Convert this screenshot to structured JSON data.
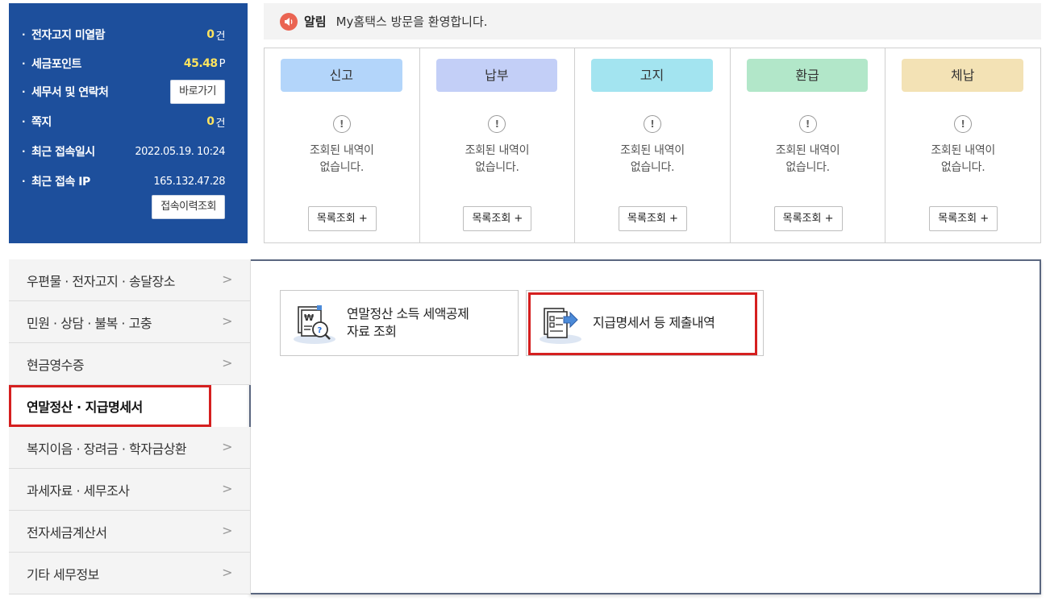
{
  "info": {
    "rows": [
      {
        "label": "전자고지 미열람",
        "value": "0",
        "unit": "건"
      },
      {
        "label": "세금포인트",
        "value": "45.48",
        "unit": "P"
      },
      {
        "label": "세무서 및 연락처",
        "button": "바로가기"
      },
      {
        "label": "쪽지",
        "value": "0",
        "unit": "건"
      },
      {
        "label": "최근 접속일시",
        "text": "2022.05.19.  10:24"
      },
      {
        "label": "최근 접속 IP",
        "text": "165.132.47.28",
        "button": "접속이력조회"
      }
    ]
  },
  "notice": {
    "title": "알림",
    "text": "My홈택스 방문을 환영합니다."
  },
  "status": {
    "empty_line1": "조회된 내역이",
    "empty_line2": "없습니다.",
    "button": "목록조회 +",
    "columns": [
      {
        "label": "신고",
        "color": "#b3d5fa"
      },
      {
        "label": "납부",
        "color": "#c3cff7"
      },
      {
        "label": "고지",
        "color": "#a3e4f0"
      },
      {
        "label": "환급",
        "color": "#b2e7c9"
      },
      {
        "label": "체납",
        "color": "#f3e2b5"
      }
    ]
  },
  "menu": {
    "items": [
      {
        "label": "우편물 · 전자고지 · 송달장소"
      },
      {
        "label": "민원 · 상담 · 불복 · 고충"
      },
      {
        "label": "현금영수증"
      },
      {
        "label": "연말정산 · 지급명세서",
        "active": true
      },
      {
        "label": "복지이음 · 장려금 · 학자금상환"
      },
      {
        "label": "과세자료 · 세무조사"
      },
      {
        "label": "전자세금계산서"
      },
      {
        "label": "기타 세무정보"
      }
    ]
  },
  "cards": [
    {
      "line1": "연말정산 소득 세액공제",
      "line2": "자료 조회"
    },
    {
      "line1": "지급명세서 등 제출내역"
    }
  ],
  "colors": {
    "panel": "#1d4f9c",
    "highlight": "#d51f1f",
    "accent_value": "#ffe45e"
  }
}
